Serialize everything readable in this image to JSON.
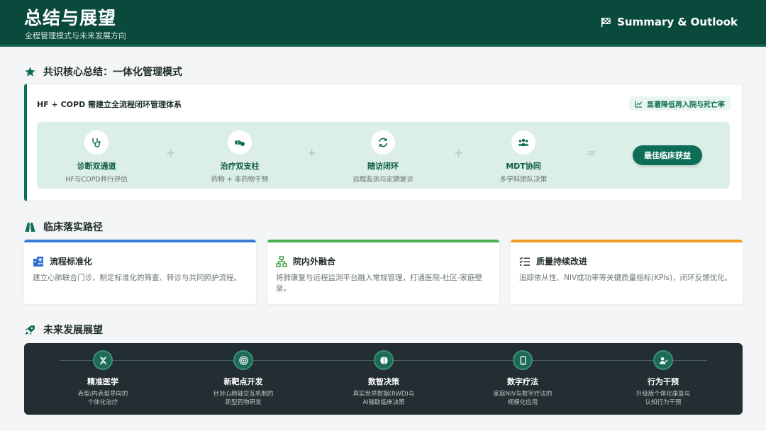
{
  "header": {
    "title": "总结与展望",
    "subtitle": "全程管理模式与未来发展方向",
    "badge": "Summary & Outlook"
  },
  "section1": {
    "title": "共识核心总结：一体化管理模式",
    "heading": "HF + COPD 需建立全流程闭环管理体系",
    "tag": "显著降低再入院与死亡率",
    "steps": [
      {
        "icon": "stethoscope-icon",
        "label": "诊断双通道",
        "sub": "HF与COPD并行评估"
      },
      {
        "icon": "pills-icon",
        "label": "治疗双支柱",
        "sub": "药物 + 非药物干预"
      },
      {
        "icon": "sync-icon",
        "label": "随访闭环",
        "sub": "远程监测与定期复诊"
      },
      {
        "icon": "team-icon",
        "label": "MDT协同",
        "sub": "多学科团队决策"
      }
    ],
    "ops": [
      "+",
      "+",
      "+",
      "="
    ],
    "result": "最佳临床获益"
  },
  "section2": {
    "title": "临床落实路径",
    "cards": [
      {
        "icon": "hospital-icon",
        "title": "流程标准化",
        "desc": "建立心肺联合门诊，制定标准化的筛查、转诊与共同照护流程。",
        "color": "#3a7bd5"
      },
      {
        "icon": "network-icon",
        "title": "院内外融合",
        "desc": "将肺康复与远程监测平台融入常规管理，打通医院-社区-家庭壁垒。",
        "color": "#4caf50"
      },
      {
        "icon": "checklist-icon",
        "title": "质量持续改进",
        "desc": "追踪依从性、NIV成功率等关键质量指标(KPIs)，闭环反馈优化。",
        "color": "#f29a26"
      }
    ]
  },
  "section3": {
    "title": "未来发展展望",
    "items": [
      {
        "icon": "dna-icon",
        "label": "精准医学",
        "desc": "表型/内表型导向的个体化治疗"
      },
      {
        "icon": "target-icon",
        "label": "新靶点开发",
        "desc": "针对心肺轴交互机制的新型药物研发"
      },
      {
        "icon": "brain-icon",
        "label": "数智决策",
        "desc": "真实世界数据(RWD)与AI辅助临床决策"
      },
      {
        "icon": "phone-icon",
        "label": "数字疗法",
        "desc": "家庭NIV与数字疗法的规模化应用"
      },
      {
        "icon": "user-check-icon",
        "label": "行为干预",
        "desc": "升级版个体化康复与认知行为干预"
      }
    ]
  }
}
